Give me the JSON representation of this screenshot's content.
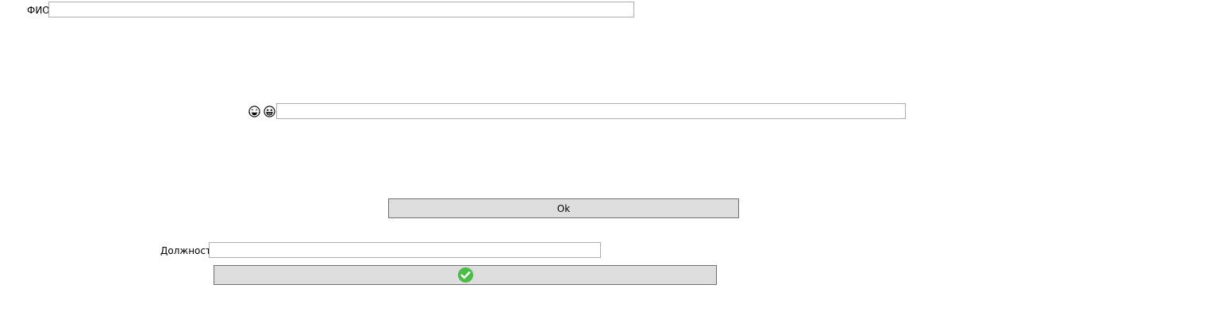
{
  "form": {
    "fio_label": "ФИО",
    "fio_value": "",
    "emoji_field_value": "",
    "ok_button_label": "Ok",
    "position_label": "Должность",
    "position_value": ""
  },
  "icons": {
    "emoji_1": "laughing-tears-face-icon",
    "emoji_2": "grinning-squinting-face-icon",
    "confirm": "green-check-circle-icon"
  },
  "colors": {
    "button_bg": "#dddddd",
    "button_border": "#707070",
    "input_border": "#abadb3",
    "check_green": "#4cbb47"
  }
}
